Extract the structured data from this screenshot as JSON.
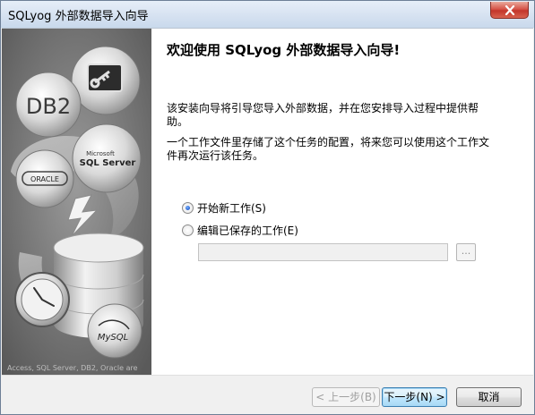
{
  "window": {
    "title": "SQLyog 外部数据导入向导"
  },
  "side_panel": {
    "caption": "Access, SQL Server, DB2, Oracle are",
    "logos": {
      "db2": "DB2",
      "ms_small": "Microsoft",
      "sqlserver": "SQL Server",
      "oracle": "ORACLE",
      "mysql": "MySQL"
    }
  },
  "content": {
    "heading": "欢迎使用 SQLyog 外部数据导入向导!",
    "paragraph1": "该安装向导将引导您导入外部数据，并在您安排导入过程中提供帮助。",
    "paragraph2": "一个工作文件里存储了这个任务的配置，将来您可以使用这个工作文件再次运行该任务。",
    "options": [
      {
        "label": "开始新工作(S)",
        "checked": true
      },
      {
        "label": "编辑已保存的工作(E)",
        "checked": false
      }
    ],
    "job_file_path": "",
    "browse_label": "..."
  },
  "buttons": {
    "back": "< 上一步(B)",
    "next": "下一步(N) >",
    "cancel": "取消"
  },
  "colors": {
    "panel_gray": "#6e6e6e",
    "titlebar": "#d6e2f1",
    "close_red": "#c3352b",
    "default_button_border": "#3c7fb1"
  }
}
